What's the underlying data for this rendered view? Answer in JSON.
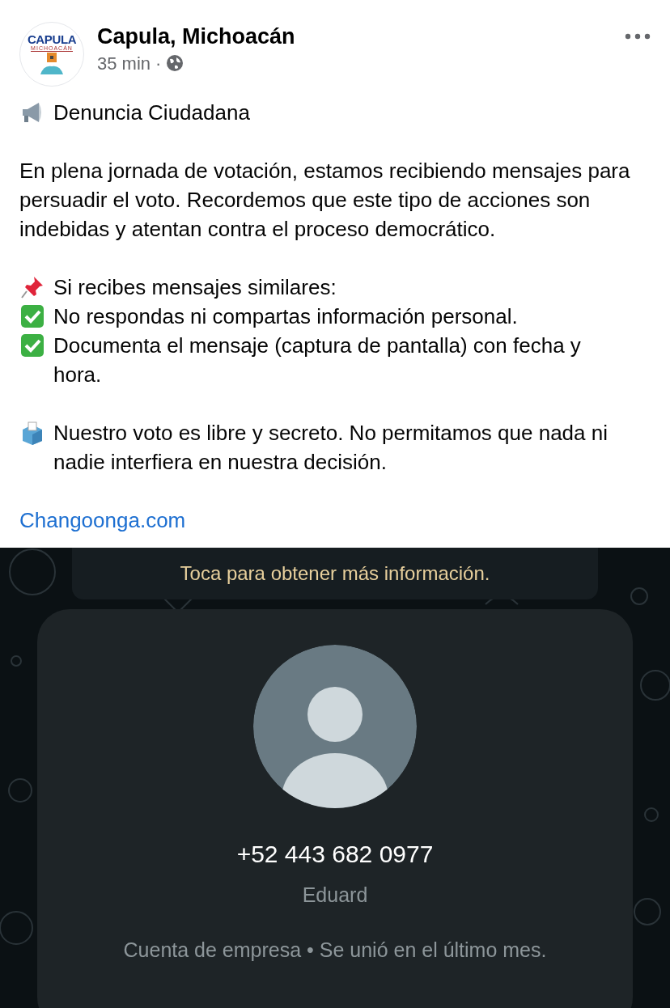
{
  "post": {
    "author": "Capula, Michoacán",
    "logo_text": "CAPULA",
    "logo_subtext": "MICHOACÁN",
    "time": "35 min",
    "separator": "·"
  },
  "body": [
    {
      "kind": "megaphone",
      "text": "Denuncia Ciudadana"
    },
    {
      "kind": "gap"
    },
    {
      "kind": "plain",
      "text": "En plena jornada de votación, estamos recibiendo mensajes para persuadir el voto. Recordemos que este tipo de acciones son indebidas y atentan contra el proceso democrático."
    },
    {
      "kind": "gap"
    },
    {
      "kind": "pin",
      "text": "Si recibes mensajes similares:"
    },
    {
      "kind": "check",
      "text": "No respondas ni compartas información personal."
    },
    {
      "kind": "check",
      "text": "Documenta el mensaje (captura de pantalla) con fecha y hora."
    },
    {
      "kind": "gap"
    },
    {
      "kind": "ballot",
      "text": "Nuestro voto es libre y secreto. No permitamos que nada ni nadie interfiera en nuestra decisión."
    },
    {
      "kind": "gap"
    },
    {
      "kind": "link",
      "text": "Changoonga.com"
    }
  ],
  "chat_screenshot": {
    "notice": "Toca para obtener más información.",
    "phone": "+52 443 682 0977",
    "contact_name": "Eduard",
    "account_info": "Cuenta de empresa • Se unió en el último mes."
  }
}
